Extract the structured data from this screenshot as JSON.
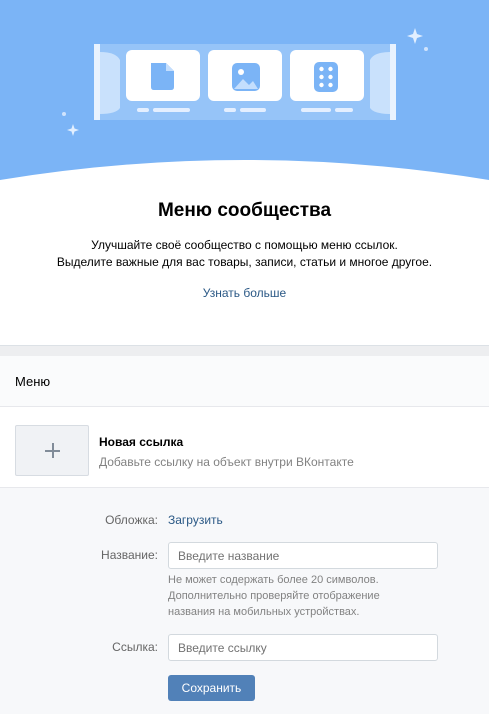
{
  "hero": {
    "title": "Меню сообщества",
    "description_line1": "Улучшайте своё сообщество с помощью меню ссылок.",
    "description_line2": "Выделите важные для вас товары, записи, статьи и многое другое.",
    "learn_more": "Узнать больше",
    "illustration_icons": [
      "document-icon",
      "image-icon",
      "grid-icon"
    ]
  },
  "menu": {
    "header": "Меню"
  },
  "new_link": {
    "title": "Новая ссылка",
    "subtitle": "Добавьте ссылку на объект внутри ВКонтакте"
  },
  "form": {
    "cover_label": "Обложка:",
    "cover_action": "Загрузить",
    "name_label": "Название:",
    "name_value": "",
    "name_placeholder": "Введите название",
    "name_hint_line1": "Не может содержать более 20 символов.",
    "name_hint_line2": "Дополнительно проверяйте отображение",
    "name_hint_line3": "названия на мобильных устройствах.",
    "link_label": "Ссылка:",
    "link_value": "",
    "link_placeholder": "Введите ссылку",
    "save_label": "Сохранить"
  },
  "colors": {
    "hero_blue": "#7bb4f6",
    "link": "#2a5885",
    "button": "#5181b8"
  }
}
